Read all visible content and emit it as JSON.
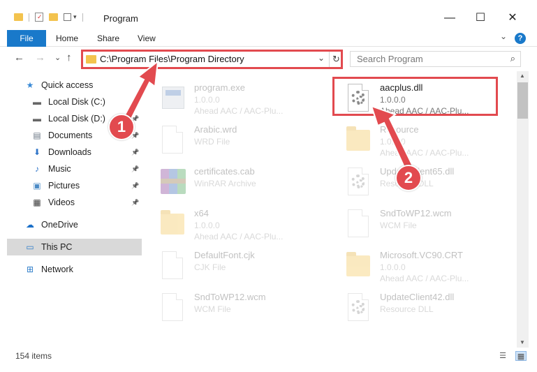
{
  "window": {
    "title": "Program",
    "minimize_glyph": "—",
    "maximize_glyph": "☐",
    "close_glyph": "✕"
  },
  "ribbon": {
    "file_label": "File",
    "home_label": "Home",
    "share_label": "Share",
    "view_label": "View",
    "help_glyph": "?"
  },
  "nav": {
    "back_glyph": "←",
    "forward_glyph": "→",
    "recent_glyph": "⌄",
    "up_glyph": "↑",
    "address": "C:\\Program Files\\Program Directory",
    "search_placeholder": "Search Program"
  },
  "sidebar": {
    "items": [
      {
        "label": "Quick access",
        "icon": "star-icon",
        "glyph": "★",
        "color": "#3a8ad6"
      },
      {
        "label": "Local Disk (C:)",
        "icon": "drive-icon",
        "glyph": "▬",
        "color": "#666666",
        "pinned": true
      },
      {
        "label": "Local Disk (D:)",
        "icon": "drive-icon",
        "glyph": "▬",
        "color": "#666666",
        "pinned": true
      },
      {
        "label": "Documents",
        "icon": "documents-icon",
        "glyph": "▤",
        "color": "#6b7785",
        "pinned": true
      },
      {
        "label": "Downloads",
        "icon": "downloads-icon",
        "glyph": "⬇",
        "color": "#2e74c8",
        "pinned": true
      },
      {
        "label": "Music",
        "icon": "music-icon",
        "glyph": "♪",
        "color": "#2e74c8",
        "pinned": true
      },
      {
        "label": "Pictures",
        "icon": "pictures-icon",
        "glyph": "▣",
        "color": "#4c8bc6",
        "pinned": true
      },
      {
        "label": "Videos",
        "icon": "videos-icon",
        "glyph": "▦",
        "color": "#3a3a3a",
        "pinned": true
      },
      {
        "label": "OneDrive",
        "icon": "onedrive-icon",
        "glyph": "☁",
        "color": "#1a6fc8"
      },
      {
        "label": "This PC",
        "icon": "this-pc-icon",
        "glyph": "▭",
        "color": "#2c7cc9",
        "selected": true
      },
      {
        "label": "Network",
        "icon": "network-icon",
        "glyph": "⊞",
        "color": "#2c7cc9"
      }
    ]
  },
  "files": [
    {
      "name": "program.exe",
      "sub1": "1.0.0.0",
      "sub2": "Ahead AAC / AAC-Plu...",
      "kind": "exe",
      "faded": true
    },
    {
      "name": "aacplus.dll",
      "sub1": "1.0.0.0",
      "sub2": "Ahead AAC / AAC-Plu...",
      "kind": "dll",
      "faded": false
    },
    {
      "name": "Arabic.wrd",
      "sub1": "WRD File",
      "sub2": "",
      "kind": "doc",
      "faded": true
    },
    {
      "name": "Resource",
      "sub1": "1.0.0.0",
      "sub2": "Ahead AAC / AAC-Plu...",
      "kind": "folder",
      "faded": true
    },
    {
      "name": "certificates.cab",
      "sub1": "WinRAR Archive",
      "sub2": "",
      "kind": "winrar",
      "faded": true
    },
    {
      "name": "UpdateClient65.dll",
      "sub1": "Resource DLL",
      "sub2": "",
      "kind": "dll",
      "faded": true
    },
    {
      "name": "x64",
      "sub1": "1.0.0.0",
      "sub2": "Ahead AAC / AAC-Plu...",
      "kind": "folder",
      "faded": true
    },
    {
      "name": "SndToWP12.wcm",
      "sub1": "WCM File",
      "sub2": "",
      "kind": "doc",
      "faded": true
    },
    {
      "name": "DefaultFont.cjk",
      "sub1": "CJK File",
      "sub2": "",
      "kind": "doc",
      "faded": true
    },
    {
      "name": "Microsoft.VC90.CRT",
      "sub1": "1.0.0.0",
      "sub2": "Ahead AAC / AAC-Plu...",
      "kind": "folder",
      "faded": true
    },
    {
      "name": "SndToWP12.wcm",
      "sub1": "WCM File",
      "sub2": "",
      "kind": "doc",
      "faded": true
    },
    {
      "name": "UpdateClient42.dll",
      "sub1": "Resource DLL",
      "sub2": "",
      "kind": "dll",
      "faded": true
    }
  ],
  "status": {
    "item_count": "154 items"
  },
  "annotations": {
    "step1": "1",
    "step2": "2",
    "accent_color": "#e24a4f"
  }
}
